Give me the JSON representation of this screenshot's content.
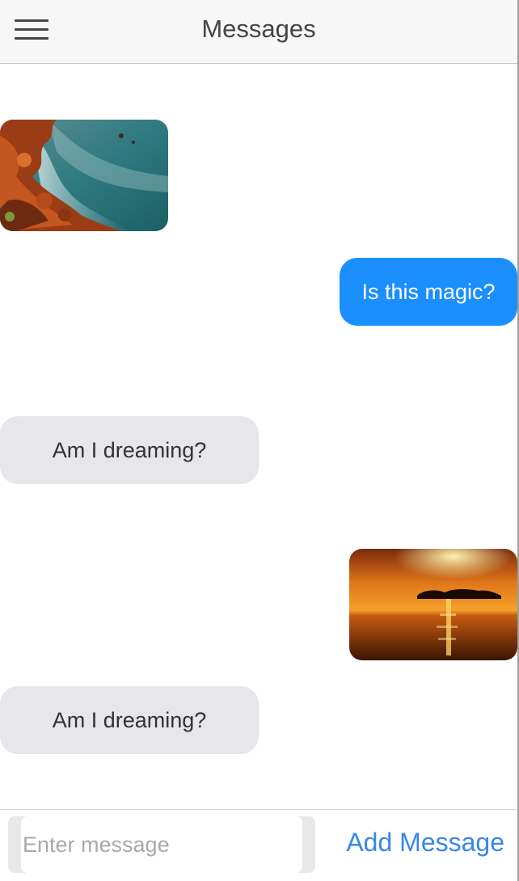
{
  "header": {
    "title": "Messages",
    "menu_icon": "hamburger-menu-icon"
  },
  "messages": [
    {
      "type": "image",
      "direction": "incoming",
      "description": "coastal-rocks-photo"
    },
    {
      "type": "text",
      "direction": "outgoing",
      "text": "Is this magic?"
    },
    {
      "type": "text",
      "direction": "incoming",
      "text": "Am I dreaming?"
    },
    {
      "type": "image",
      "direction": "outgoing",
      "description": "sunset-island-photo"
    },
    {
      "type": "text",
      "direction": "incoming",
      "text": "Am I dreaming?"
    }
  ],
  "composer": {
    "placeholder": "Enter message",
    "value": "",
    "send_label": "Add Message"
  },
  "colors": {
    "outgoing_bubble": "#1a8ffd",
    "incoming_bubble": "#e6e6eb",
    "link": "#3a86e8",
    "header_bg": "#f7f7f7"
  }
}
